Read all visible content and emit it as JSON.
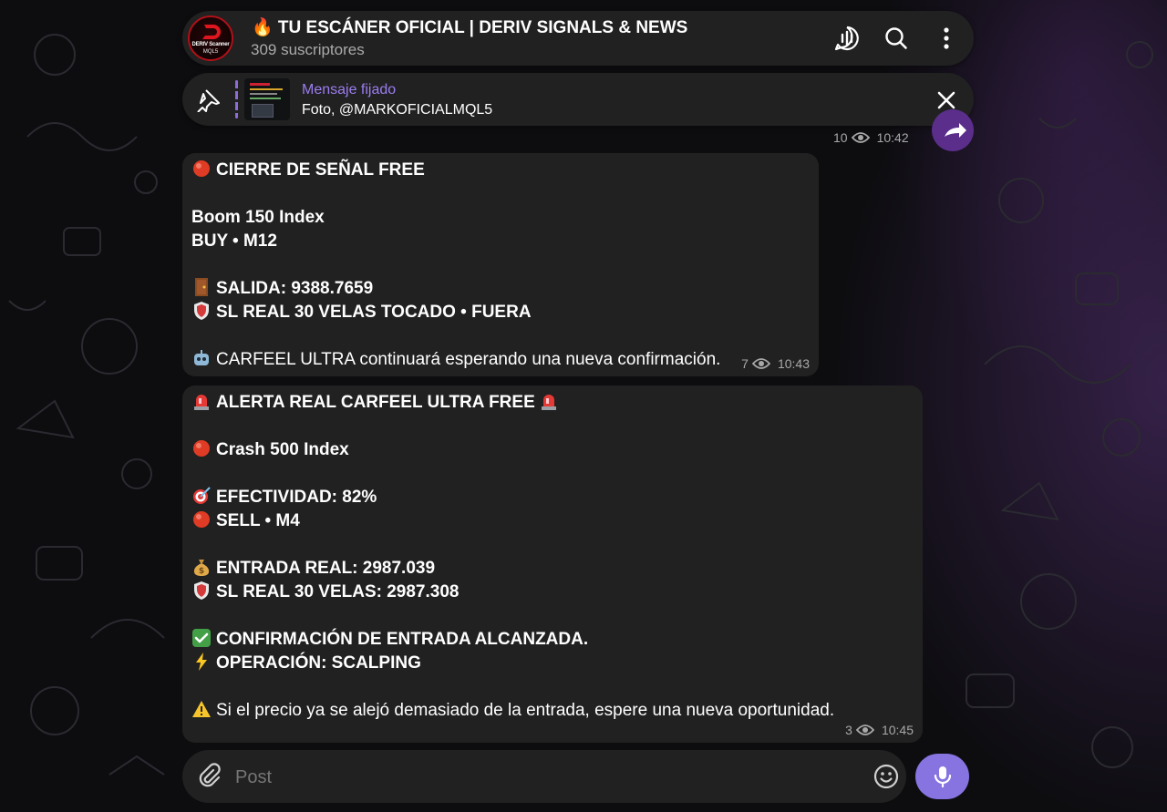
{
  "header": {
    "title": "🔥 TU ESCÁNER OFICIAL | DERIV SIGNALS & NEWS",
    "subscribers": "309 suscriptores",
    "avatar_line1": "DERIV Scanner",
    "avatar_line2": "MQL5",
    "icons": [
      "live-stream-icon",
      "search-icon",
      "more-vertical-icon"
    ]
  },
  "pinned": {
    "label": "Mensaje fijado",
    "text": "Foto, @MARKOFICIALMQL5",
    "icons": [
      "pin-icon",
      "close-icon"
    ]
  },
  "previous_message": {
    "views": "10",
    "time": "10:42"
  },
  "messages": [
    {
      "lines": [
        {
          "emoji": "red-circle",
          "text": "CIERRE DE SEÑAL FREE",
          "bold": true
        },
        {
          "gap": true
        },
        {
          "text": "Boom 150 Index",
          "bold": true
        },
        {
          "text": "BUY • M12",
          "bold": true
        },
        {
          "gap": true
        },
        {
          "emoji": "door",
          "text": "SALIDA: 9388.7659",
          "bold": true
        },
        {
          "emoji": "shield",
          "text": "SL REAL 30 VELAS TOCADO • FUERA",
          "bold": true
        },
        {
          "gap": true
        },
        {
          "emoji": "robot",
          "text": "CARFEEL ULTRA continuará esperando una nueva confirmación.",
          "bold": false
        }
      ],
      "views": "7",
      "time": "10:43"
    },
    {
      "lines": [
        {
          "emoji": "siren",
          "text": "ALERTA REAL CARFEEL ULTRA FREE",
          "bold": true,
          "trailing_emoji": "siren"
        },
        {
          "gap": true
        },
        {
          "emoji": "red-circle",
          "text": "Crash 500 Index",
          "bold": true
        },
        {
          "gap": true
        },
        {
          "emoji": "target",
          "text": "EFECTIVIDAD: 82%",
          "bold": true
        },
        {
          "emoji": "red-circle",
          "text": "SELL • M4",
          "bold": true
        },
        {
          "gap": true
        },
        {
          "emoji": "money-bag",
          "text": "ENTRADA REAL: 2987.039",
          "bold": true
        },
        {
          "emoji": "shield",
          "text": "SL REAL 30 VELAS: 2987.308",
          "bold": true
        },
        {
          "gap": true
        },
        {
          "emoji": "check",
          "text": "CONFIRMACIÓN DE ENTRADA ALCANZADA.",
          "bold": true
        },
        {
          "emoji": "lightning",
          "text": "OPERACIÓN: SCALPING",
          "bold": true
        },
        {
          "gap": true
        },
        {
          "emoji": "warning",
          "text": "Si el precio ya se alejó demasiado de la entrada, espere una nueva oportunidad.",
          "bold": false
        }
      ],
      "views": "3",
      "time": "10:45"
    }
  ],
  "composer": {
    "placeholder": "Post",
    "icons": [
      "attach-icon",
      "emoji-icon",
      "microphone-icon"
    ]
  },
  "colors": {
    "bubble": "#212121",
    "accent": "#8774e1",
    "pinned_label": "#9b7df0",
    "meta_text": "#a8a8a8"
  }
}
